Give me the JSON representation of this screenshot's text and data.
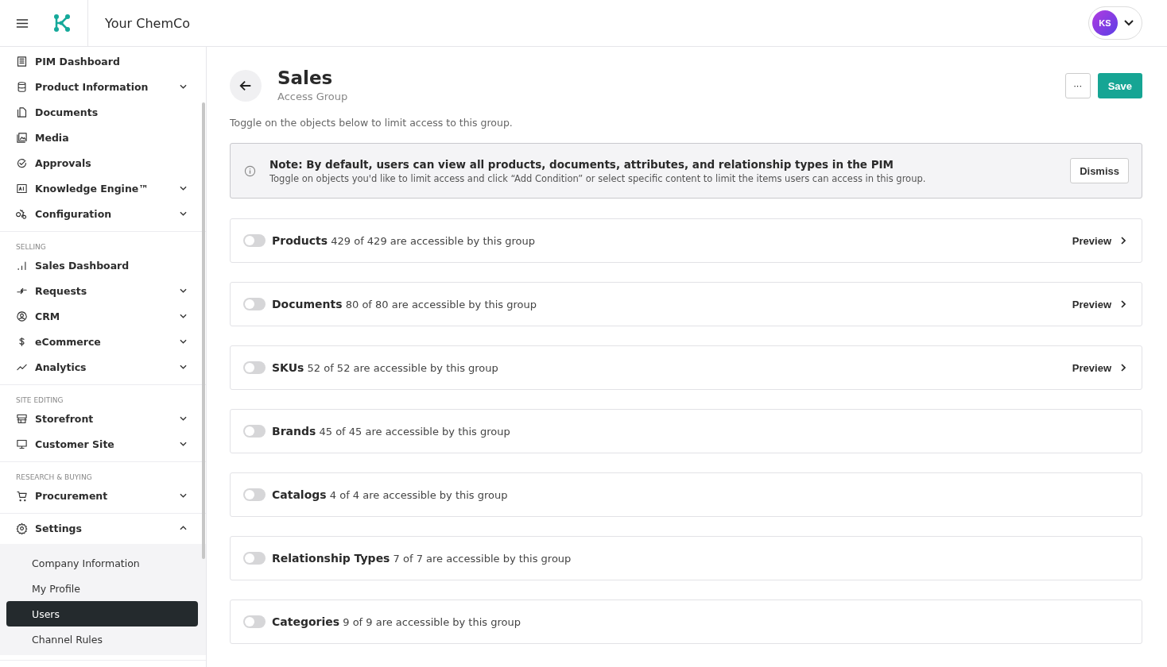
{
  "header": {
    "brand": "Your ChemCo",
    "avatar": "KS"
  },
  "sidebar": {
    "sections": [
      {
        "items": [
          {
            "label": "PIM Dashboard"
          },
          {
            "label": "Product Information",
            "expanded": false
          },
          {
            "label": "Documents"
          },
          {
            "label": "Media"
          },
          {
            "label": "Approvals"
          },
          {
            "label": "Knowledge Engine™",
            "expanded": false
          },
          {
            "label": "Configuration",
            "expanded": false
          }
        ]
      },
      {
        "title": "SELLING",
        "items": [
          {
            "label": "Sales Dashboard"
          },
          {
            "label": "Requests",
            "expanded": false
          },
          {
            "label": "CRM",
            "expanded": false
          },
          {
            "label": "eCommerce",
            "expanded": false
          },
          {
            "label": "Analytics",
            "expanded": false
          }
        ]
      },
      {
        "title": "SITE EDITING",
        "items": [
          {
            "label": "Storefront",
            "expanded": false
          },
          {
            "label": "Customer Site",
            "expanded": false
          }
        ]
      },
      {
        "title": "RESEARCH & BUYING",
        "items": [
          {
            "label": "Procurement",
            "expanded": false
          }
        ]
      },
      {
        "items": [
          {
            "label": "Settings",
            "expanded": true,
            "children": [
              {
                "label": "Company Information",
                "selected": false
              },
              {
                "label": "My Profile",
                "selected": false
              },
              {
                "label": "Users",
                "selected": true
              },
              {
                "label": "Channel Rules",
                "selected": false
              }
            ]
          }
        ]
      }
    ]
  },
  "page": {
    "title": "Sales",
    "subtitle": "Access Group",
    "more": "···",
    "save": "Save",
    "intro": "Toggle on the objects below to limit access to this group."
  },
  "note": {
    "title": "Note: By default, users can view all products, documents, attributes, and relationship types in the PIM",
    "text": "Toggle on objects you'd like to limit access and click “Add Condition” or select specific content to limit the items users can access in this group.",
    "dismiss": "Dismiss"
  },
  "objects": [
    {
      "name": "Products",
      "text": "429 of 429 are accessible by this group",
      "on": false,
      "preview": "Preview"
    },
    {
      "name": "Documents",
      "text": "80 of 80 are accessible by this group",
      "on": false,
      "preview": "Preview"
    },
    {
      "name": "SKUs",
      "text": "52 of 52 are accessible by this group",
      "on": false,
      "preview": "Preview"
    },
    {
      "name": "Brands",
      "text": "45 of 45 are accessible by this group",
      "on": false
    },
    {
      "name": "Catalogs",
      "text": "4 of 4 are accessible by this group",
      "on": false
    },
    {
      "name": "Relationship Types",
      "text": "7 of 7 are accessible by this group",
      "on": false
    },
    {
      "name": "Categories",
      "text": "9 of 9 are accessible by this group",
      "on": false
    }
  ]
}
